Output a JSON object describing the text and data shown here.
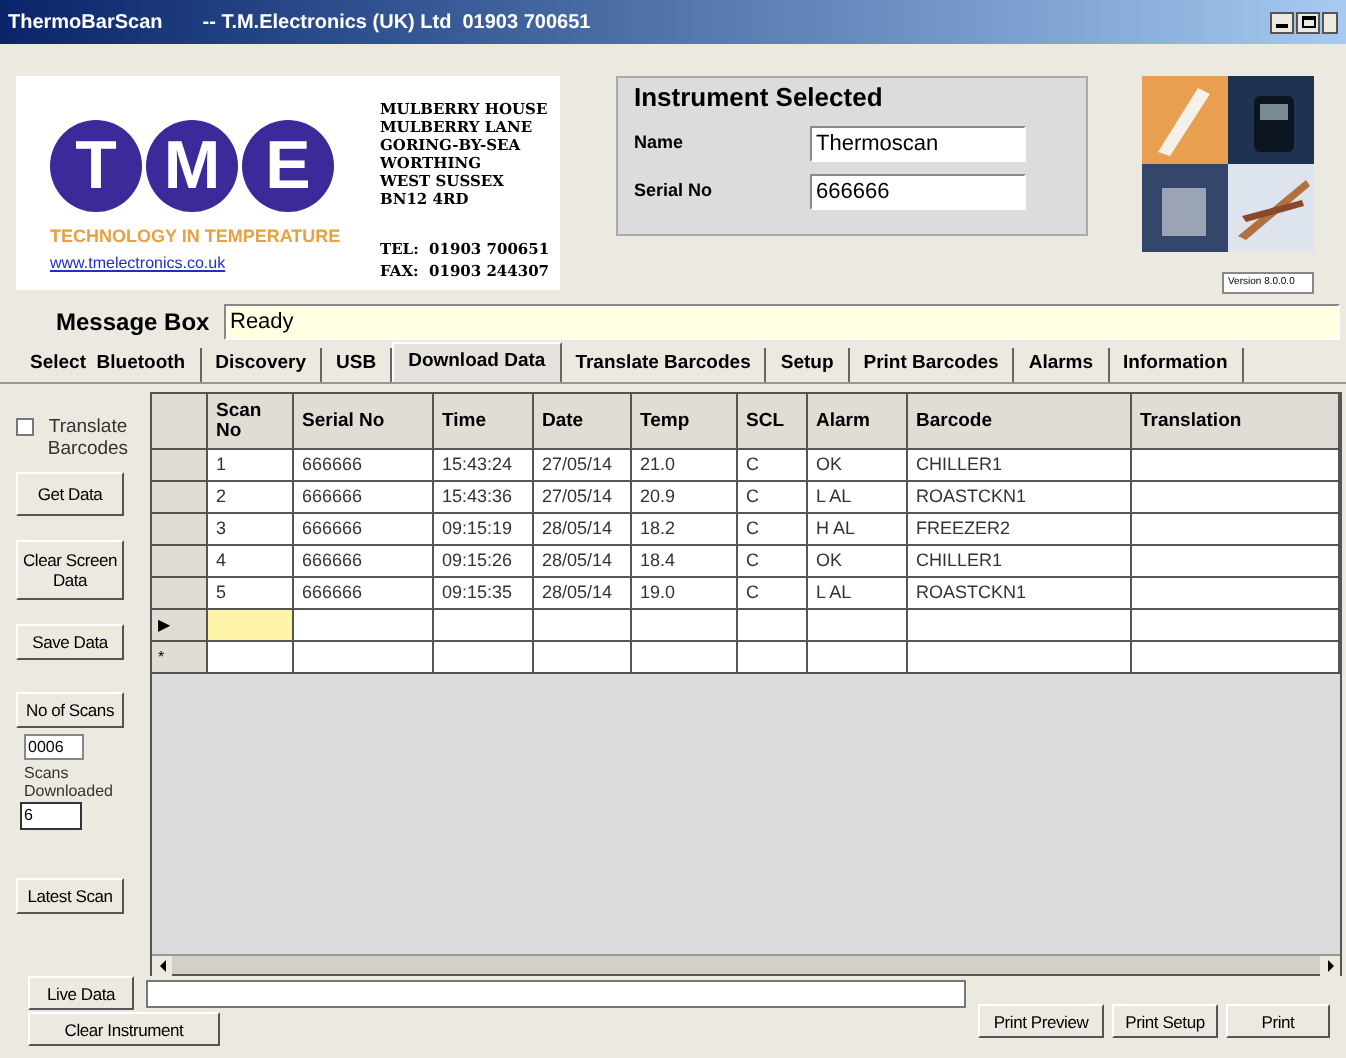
{
  "window": {
    "title": "ThermoBarScan",
    "subtitle": "-- T.M.Electronics (UK) Ltd  01903 700651"
  },
  "logo": {
    "letters": [
      "T",
      "M",
      "E"
    ],
    "tagline": "TECHNOLOGY IN TEMPERATURE",
    "link": "www.tmelectronics.co.uk"
  },
  "address": [
    "MULBERRY HOUSE",
    "MULBERRY LANE",
    "GORING-BY-SEA",
    "WORTHING",
    "WEST SUSSEX",
    "BN12 4RD"
  ],
  "contact": [
    "TEL:  01903 700651",
    "FAX:  01903 244307"
  ],
  "instrument": {
    "title": "Instrument Selected",
    "fields": [
      {
        "label": "Name",
        "value": "Thermoscan"
      },
      {
        "label": "Serial No",
        "value": "666666"
      }
    ]
  },
  "version": "Version 8.0.0.0",
  "message_box": {
    "label": "Message Box",
    "value": "Ready"
  },
  "tabs": [
    {
      "label": "Select  Bluetooth",
      "selected": false
    },
    {
      "label": "Discovery",
      "selected": false
    },
    {
      "label": "USB",
      "selected": false
    },
    {
      "label": "Download Data",
      "selected": true
    },
    {
      "label": "Translate Barcodes",
      "selected": false
    },
    {
      "label": "Setup",
      "selected": false
    },
    {
      "label": "Print Barcodes",
      "selected": false
    },
    {
      "label": "Alarms",
      "selected": false
    },
    {
      "label": "Information",
      "selected": false
    }
  ],
  "sidebar": {
    "translate_checkbox": {
      "label": "Translate Barcodes",
      "checked": false
    },
    "get_data": "Get Data",
    "clear_screen": "Clear Screen Data",
    "save_data": "Save Data",
    "no_of_scans": "No of Scans",
    "scans_value": "0006",
    "scans_downloaded_label": "Scans Downloaded",
    "scans_downloaded_value": "6",
    "latest_scan": "Latest Scan"
  },
  "table": {
    "columns": [
      "Scan No",
      "Serial No",
      "Time",
      "Date",
      "Temp",
      "SCL",
      "Alarm",
      "Barcode",
      "Translation"
    ],
    "rows": [
      [
        "1",
        "666666",
        "15:43:24",
        "27/05/14",
        "21.0",
        "C",
        "OK",
        "CHILLER1",
        ""
      ],
      [
        "2",
        "666666",
        "15:43:36",
        "27/05/14",
        "20.9",
        "C",
        "L AL",
        "ROASTCKN1",
        ""
      ],
      [
        "3",
        "666666",
        "09:15:19",
        "28/05/14",
        "18.2",
        "C",
        "H AL",
        "FREEZER2",
        ""
      ],
      [
        "4",
        "666666",
        "09:15:26",
        "28/05/14",
        "18.4",
        "C",
        "OK",
        "CHILLER1",
        ""
      ],
      [
        "5",
        "666666",
        "09:15:35",
        "28/05/14",
        "19.0",
        "C",
        "L AL",
        "ROASTCKN1",
        ""
      ]
    ],
    "extra_rows": [
      {
        "marker": "▶",
        "selected": true
      },
      {
        "marker": "*",
        "selected": false
      }
    ]
  },
  "bottom": {
    "live_data": "Live Data",
    "clear_instrument": "Clear Instrument",
    "print_preview": "Print Preview",
    "print_setup": "Print Setup",
    "print": "Print"
  }
}
